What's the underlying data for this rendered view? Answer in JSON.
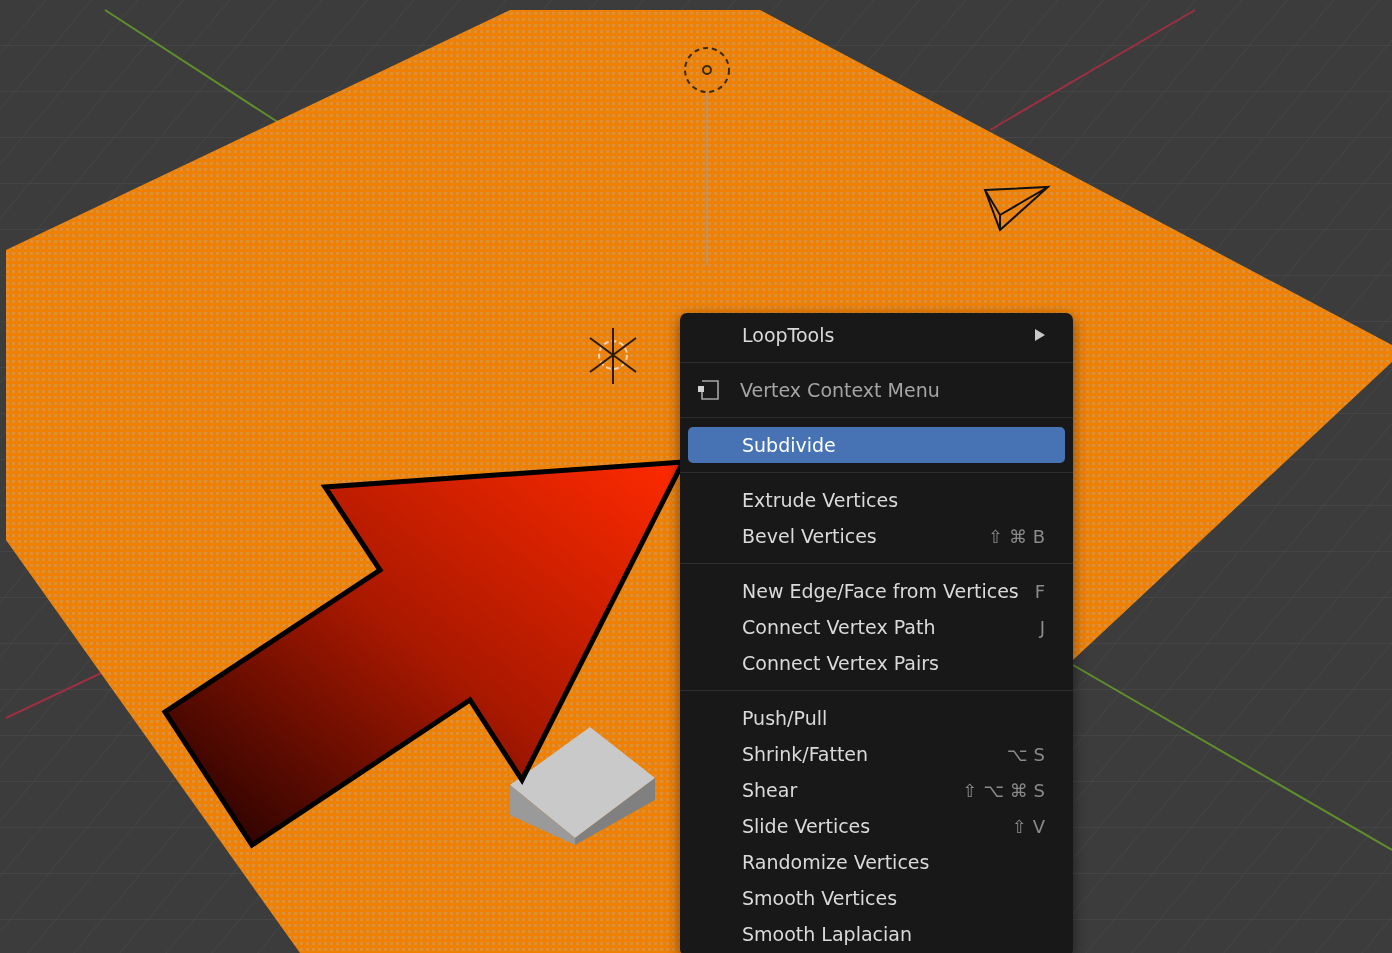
{
  "menu": {
    "sections": [
      [
        {
          "kind": "submenu",
          "label": "LoopTools",
          "selected": false
        }
      ],
      [
        {
          "kind": "header",
          "label": "Vertex Context Menu"
        }
      ],
      [
        {
          "kind": "item",
          "label": "Subdivide",
          "selected": true
        }
      ],
      [
        {
          "kind": "item",
          "label": "Extrude Vertices",
          "selected": false
        },
        {
          "kind": "item",
          "label": "Bevel Vertices",
          "shortcut": "⇧ ⌘ B",
          "selected": false
        }
      ],
      [
        {
          "kind": "item",
          "label": "New Edge/Face from Vertices",
          "shortcut": "F",
          "selected": false
        },
        {
          "kind": "item",
          "label": "Connect Vertex Path",
          "shortcut": "J",
          "selected": false
        },
        {
          "kind": "item",
          "label": "Connect Vertex Pairs",
          "selected": false
        }
      ],
      [
        {
          "kind": "item",
          "label": "Push/Pull",
          "selected": false
        },
        {
          "kind": "item",
          "label": "Shrink/Fatten",
          "shortcut": "⌥ S",
          "selected": false
        },
        {
          "kind": "item",
          "label": "Shear",
          "shortcut": "⇧ ⌥ ⌘ S",
          "selected": false
        },
        {
          "kind": "item",
          "label": "Slide Vertices",
          "shortcut": "⇧ V",
          "selected": false
        },
        {
          "kind": "item",
          "label": "Randomize Vertices",
          "selected": false
        },
        {
          "kind": "item",
          "label": "Smooth Vertices",
          "selected": false
        },
        {
          "kind": "item",
          "label": "Smooth Laplacian",
          "selected": false
        }
      ]
    ]
  }
}
